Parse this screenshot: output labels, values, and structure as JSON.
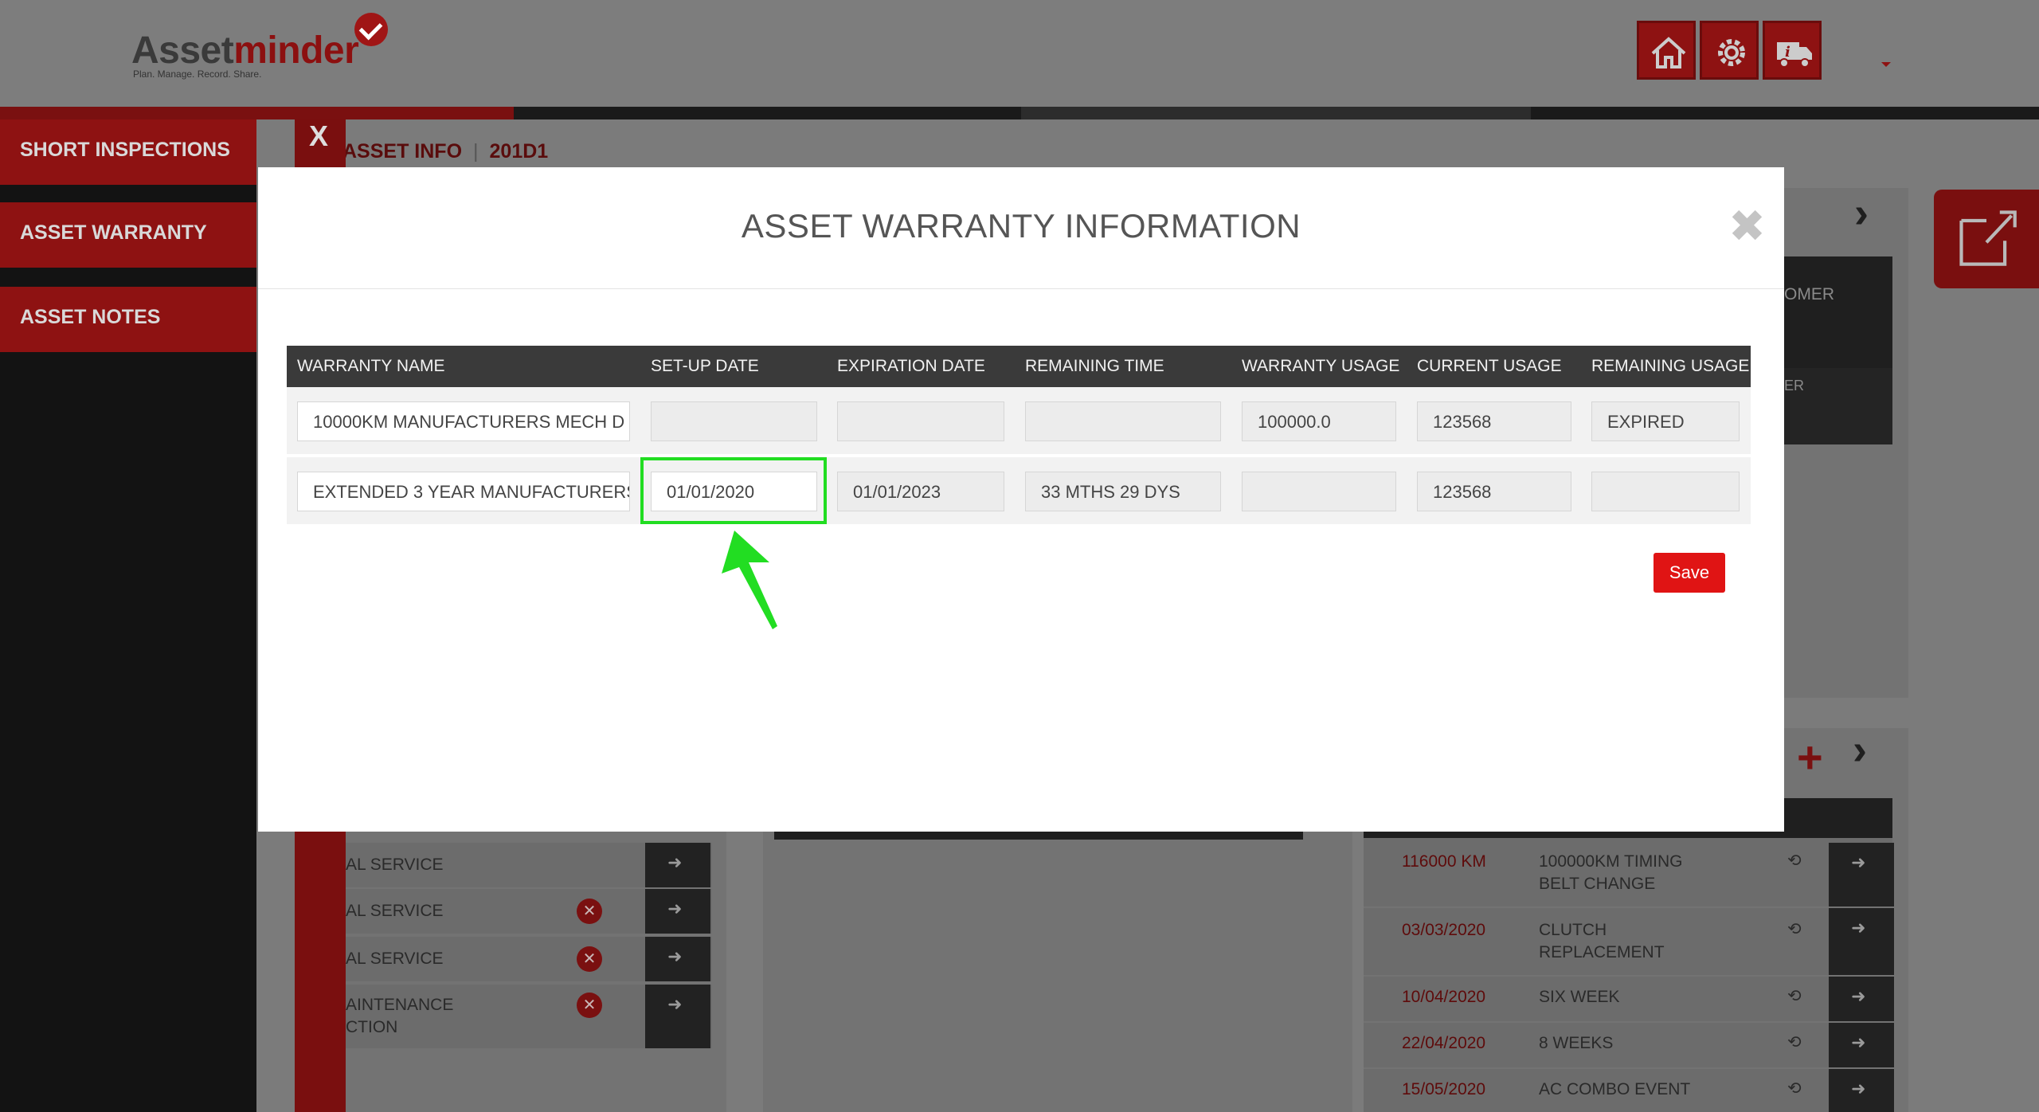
{
  "brand": {
    "name_part1": "Asset",
    "name_part2": "minder",
    "tagline": "Plan. Manage. Record. Share."
  },
  "header": {
    "buttons": [
      "home-icon",
      "settings-icon",
      "truck-info-icon"
    ]
  },
  "sidebar": {
    "close_label": "X",
    "items": [
      {
        "label": "SHORT INSPECTIONS"
      },
      {
        "label": "ASSET WARRANTY"
      },
      {
        "label": "ASSET NOTES"
      }
    ]
  },
  "breadcrumb": {
    "section": "ASSET INFO",
    "asset_id": "201D1"
  },
  "background": {
    "right_panel_labels": [
      "OMER",
      "ER"
    ],
    "service_rows": [
      {
        "label": "AL SERVICE",
        "has_delete": false
      },
      {
        "label": "AL SERVICE",
        "has_delete": true
      },
      {
        "label": "AL SERVICE",
        "has_delete": true
      },
      {
        "label": "AINTENANCE",
        "label2": "CTION",
        "has_delete": true
      }
    ],
    "history_rows": [
      {
        "value": "116000 KM",
        "title": "100000KM TIMING",
        "title2": "BELT CHANGE"
      },
      {
        "value": "03/03/2020",
        "title": "CLUTCH",
        "title2": "REPLACEMENT"
      },
      {
        "value": "10/04/2020",
        "title": "SIX WEEK",
        "title2": ""
      },
      {
        "value": "22/04/2020",
        "title": "8 WEEKS",
        "title2": ""
      },
      {
        "value": "15/05/2020",
        "title": "AC COMBO EVENT",
        "title2": ""
      }
    ]
  },
  "modal": {
    "title": "ASSET WARRANTY INFORMATION",
    "close_symbol": "✖",
    "columns": [
      "WARRANTY NAME",
      "SET-UP DATE",
      "EXPIRATION DATE",
      "REMAINING TIME",
      "WARRANTY USAGE",
      "CURRENT USAGE",
      "REMAINING USAGE"
    ],
    "rows": [
      {
        "warranty_name": "10000KM MANUFACTURERS MECH D",
        "setup_date": "",
        "expiration_date": "",
        "remaining_time": "",
        "warranty_usage": "100000.0",
        "current_usage": "123568",
        "remaining_usage": "EXPIRED"
      },
      {
        "warranty_name": "EXTENDED 3 YEAR MANUFACTURERS",
        "setup_date": "01/01/2020",
        "expiration_date": "01/01/2023",
        "remaining_time": "33 MTHS 29 DYS",
        "warranty_usage": "",
        "current_usage": "123568",
        "remaining_usage": ""
      }
    ],
    "save_label": "Save"
  },
  "colors": {
    "brand_red": "#8e1212",
    "save_red": "#e01414",
    "highlight_green": "#22dd22"
  }
}
